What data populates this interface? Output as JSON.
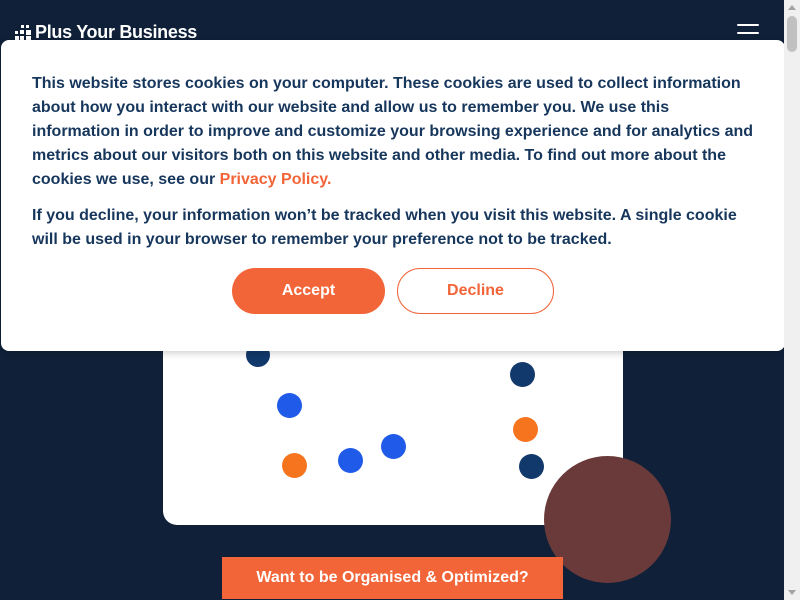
{
  "header": {
    "logo_text": "Plus Your Business",
    "logo_icon": "grid-squares-icon",
    "menu_icon": "hamburger-menu-icon"
  },
  "cookie_banner": {
    "paragraph1_text": "This website stores cookies on your computer. These cookies are used to collect information about how you interact with our website and allow us to remember you. We use this information in order to improve and customize your browsing experience and for analytics and metrics about our visitors both on this website and other media. To find out more about the cookies we use, see our ",
    "privacy_link": "Privacy Policy.",
    "paragraph2_text": "If you decline, your information won’t be tracked when you visit this website. A single cookie will be used in your browser to remember your preference not to be tracked.",
    "accept_label": "Accept",
    "decline_label": "Decline"
  },
  "hero": {
    "cta_label": "Want to be Organised & Optimized?"
  },
  "colors": {
    "background": "#0f2038",
    "accent": "#f26539",
    "text_dark": "#16365c",
    "dot_navy": "#12396b",
    "dot_blue": "#1f5be8",
    "dot_orange": "#f7741f",
    "decor_circle": "#6a3a3a"
  }
}
